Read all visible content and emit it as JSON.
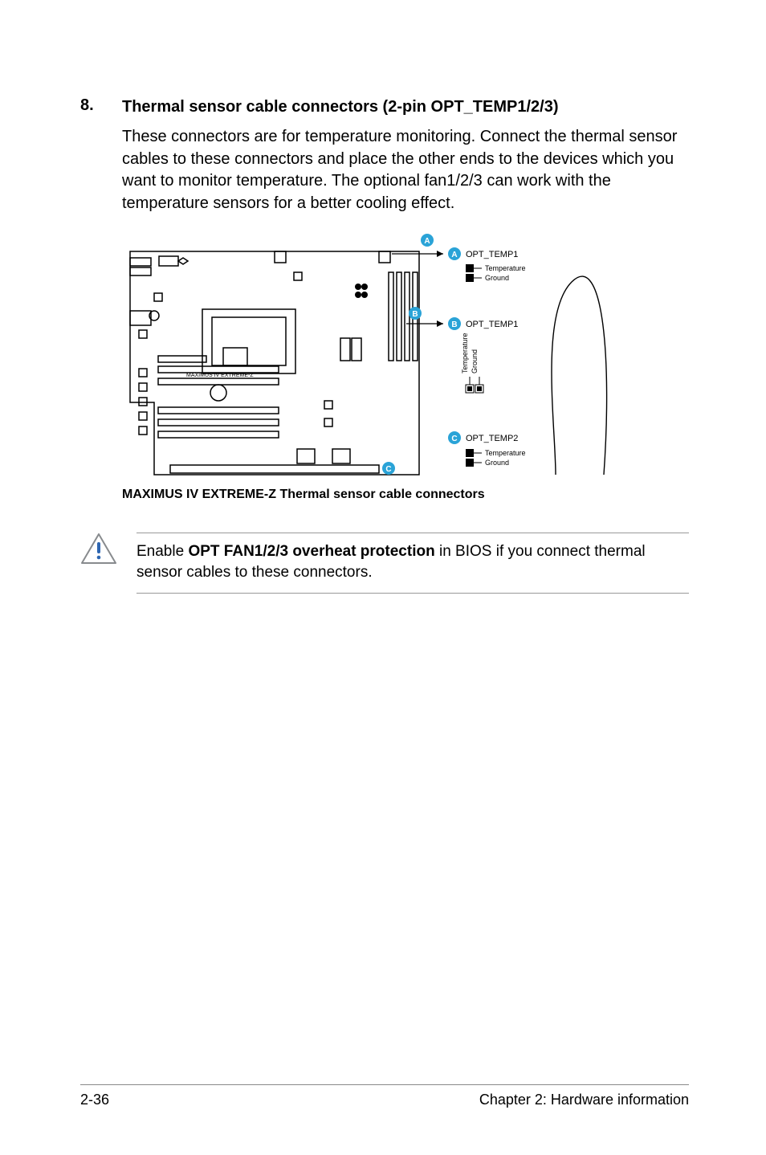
{
  "section": {
    "number": "8.",
    "title": "Thermal sensor cable connectors (2-pin OPT_TEMP1/2/3)",
    "body": "These connectors are for temperature monitoring. Connect the thermal sensor cables to these connectors and place the other ends to the devices which you want to monitor temperature. The optional fan1/2/3 can work with the temperature sensors for a better cooling effect."
  },
  "figure": {
    "caption": "MAXIMUS IV EXTREME-Z Thermal sensor cable connectors",
    "board_text": "MAXIMUS IV EXTREME-Z",
    "connectors": [
      {
        "badge": "A",
        "name": "OPT_TEMP1",
        "pins": [
          "Temperature",
          "Ground"
        ],
        "orient": "h"
      },
      {
        "badge": "B",
        "name": "OPT_TEMP1",
        "pins": [
          "Temperature",
          "Ground"
        ],
        "orient": "v"
      },
      {
        "badge": "C",
        "name": "OPT_TEMP2",
        "pins": [
          "Temperature",
          "Ground"
        ],
        "orient": "h"
      }
    ]
  },
  "note": {
    "prefix": "Enable ",
    "bold": "OPT FAN1/2/3 overheat protection",
    "suffix": " in BIOS if you connect thermal sensor cables to these connectors."
  },
  "footer": {
    "left": "2-36",
    "right": "Chapter 2: Hardware information"
  }
}
